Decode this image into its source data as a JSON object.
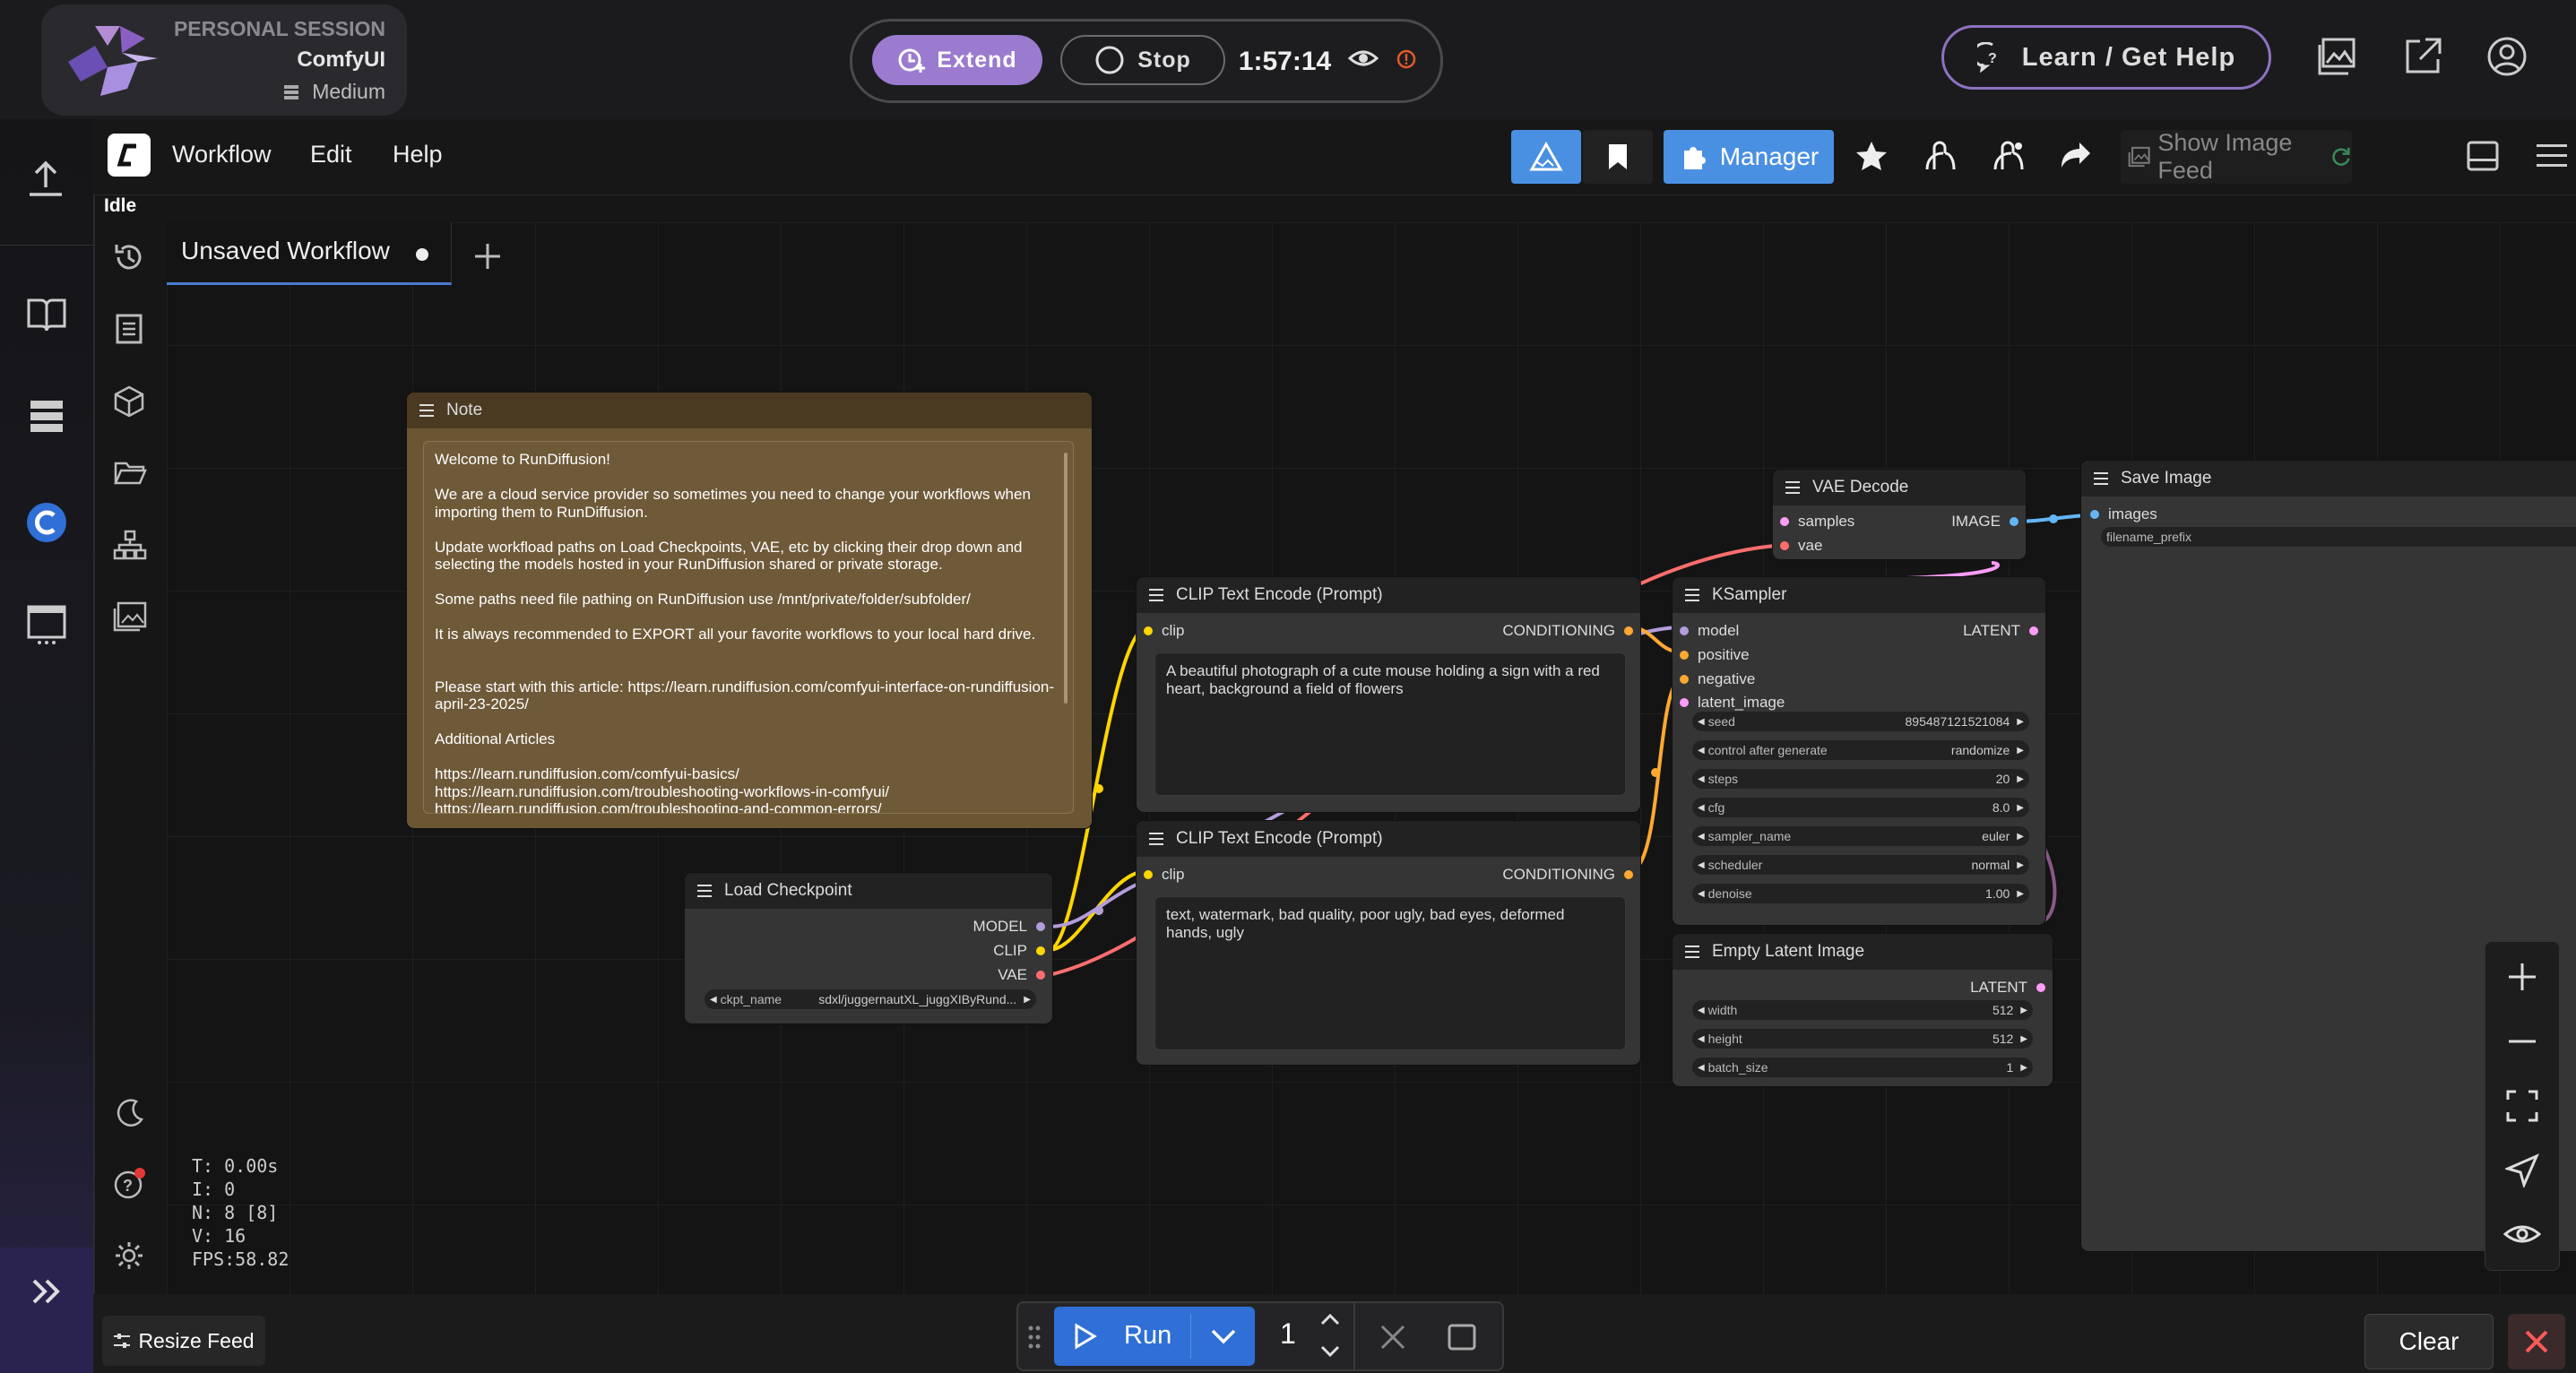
{
  "session": {
    "type": "PERSONAL SESSION",
    "app": "ComfyUI",
    "size": "Medium"
  },
  "controls": {
    "extend": "Extend",
    "stop": "Stop",
    "timer": "1:57:14"
  },
  "help": {
    "label": "Learn / Get Help"
  },
  "menu": {
    "workflow": "Workflow",
    "edit": "Edit",
    "help": "Help"
  },
  "status": {
    "idle": "Idle"
  },
  "toolbar": {
    "manager": "Manager",
    "show_feed": "Show Image Feed"
  },
  "tabs": [
    {
      "label": "Unsaved Workflow"
    }
  ],
  "colors": {
    "accent": "#9a7bd0",
    "run": "#2f6fd6",
    "model": "#b39ddb",
    "clip": "#ffd500",
    "vae": "#ff6e6e",
    "conditioning": "#ffa931",
    "latent": "#ff9cf9",
    "image": "#64b5f6"
  },
  "nodes": {
    "note": {
      "title": "Note",
      "lines": [
        "Welcome to RunDiffusion!",
        "",
        "We are a cloud service provider so sometimes you need to change your workflows when importing them to RunDiffusion.",
        "",
        "Update workfload paths on Load Checkpoints, VAE, etc by clicking their drop down and selecting the models hosted in your RunDiffusion shared or private storage.",
        "",
        "Some paths need file pathing on RunDiffusion use /mnt/private/folder/subfolder/",
        "",
        "It is always recommended to EXPORT all your favorite workflows to your local hard drive.",
        "",
        "",
        "Please start with this article: https://learn.rundiffusion.com/comfyui-interface-on-rundiffusion-april-23-2025/",
        "",
        "Additional Articles",
        "",
        "https://learn.rundiffusion.com/comfyui-basics/",
        "https://learn.rundiffusion.com/troubleshooting-workflows-in-comfyui/",
        "https://learn.rundiffusion.com/troubleshooting-and-common-errors/"
      ]
    },
    "load_checkpoint": {
      "title": "Load Checkpoint",
      "out_model": "MODEL",
      "out_clip": "CLIP",
      "out_vae": "VAE",
      "ckpt_label": "ckpt_name",
      "ckpt_value": "sdxl/juggernautXL_juggXIByRund..."
    },
    "clip_pos": {
      "title": "CLIP Text Encode (Prompt)",
      "in_clip": "clip",
      "out": "CONDITIONING",
      "text": "A beautiful photograph of a cute mouse holding a sign with a red heart, background a field of flowers"
    },
    "clip_neg": {
      "title": "CLIP Text Encode (Prompt)",
      "in_clip": "clip",
      "out": "CONDITIONING",
      "text": "text, watermark, bad quality, poor ugly, bad eyes, deformed hands, ugly"
    },
    "vae_decode": {
      "title": "VAE Decode",
      "in_samples": "samples",
      "in_vae": "vae",
      "out": "IMAGE"
    },
    "ksampler": {
      "title": "KSampler",
      "in_model": "model",
      "in_positive": "positive",
      "in_negative": "negative",
      "in_latent": "latent_image",
      "out": "LATENT",
      "widgets": [
        {
          "label": "seed",
          "value": "895487121521084"
        },
        {
          "label": "control after generate",
          "value": "randomize"
        },
        {
          "label": "steps",
          "value": "20"
        },
        {
          "label": "cfg",
          "value": "8.0"
        },
        {
          "label": "sampler_name",
          "value": "euler"
        },
        {
          "label": "scheduler",
          "value": "normal"
        },
        {
          "label": "denoise",
          "value": "1.00"
        }
      ]
    },
    "empty_latent": {
      "title": "Empty Latent Image",
      "out": "LATENT",
      "widgets": [
        {
          "label": "width",
          "value": "512"
        },
        {
          "label": "height",
          "value": "512"
        },
        {
          "label": "batch_size",
          "value": "1"
        }
      ]
    },
    "save_image": {
      "title": "Save Image",
      "in_images": "images",
      "prefix": "filename_prefix"
    }
  },
  "stats": {
    "t": "T: 0.00s",
    "i": "I: 0",
    "n": "N: 8 [8]",
    "v": "V: 16",
    "fps": "FPS:58.82"
  },
  "bottom": {
    "resize_feed": "Resize Feed",
    "run": "Run",
    "batch": "1",
    "clear": "Clear"
  }
}
